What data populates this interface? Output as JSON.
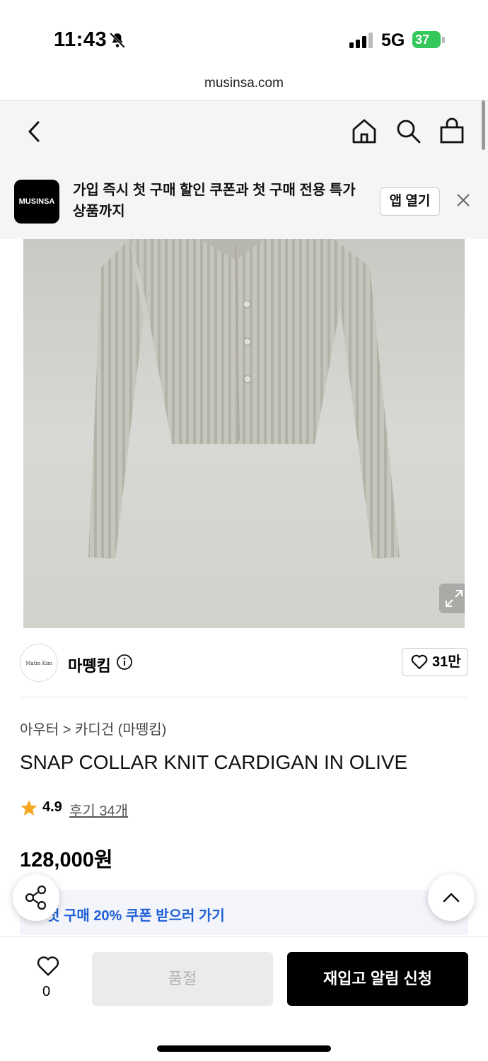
{
  "status_bar": {
    "time": "11:43",
    "network": "5G",
    "battery": "37"
  },
  "browser": {
    "url": "musinsa.com"
  },
  "promo": {
    "logo_text": "MUSINSA",
    "message": "가입 즉시 첫 구매 할인 쿠폰과 첫 구매 전용 특가 상품까지",
    "open_app_label": "앱 열기"
  },
  "brand": {
    "logo_text": "Matin Kim",
    "name": "마뗑킴",
    "likes": "31만"
  },
  "product": {
    "breadcrumb_category": "아우터",
    "breadcrumb_separator": ">",
    "breadcrumb_sub": "카디건 (마뗑킴)",
    "title": "SNAP COLLAR KNIT CARDIGAN IN OLIVE",
    "rating": "4.9",
    "reviews": "후기 34개",
    "price": "128,000원"
  },
  "coupon": {
    "text": "첫 구매 20% 쿠폰 받으러 가기"
  },
  "bottom": {
    "wish_count": "0",
    "soldout_label": "품절",
    "restock_label": "재입고 알림 신청"
  },
  "colors": {
    "accent_blue": "#1f5fd6",
    "battery_green": "#34c759",
    "cta_black": "#000000"
  },
  "icons": [
    "bell-slash-icon",
    "signal-icon",
    "back-icon",
    "home-icon",
    "search-icon",
    "bag-icon",
    "close-icon",
    "expand-icon",
    "info-icon",
    "heart-icon",
    "star-icon",
    "share-icon",
    "chevron-up-icon",
    "chevron-right-icon"
  ]
}
